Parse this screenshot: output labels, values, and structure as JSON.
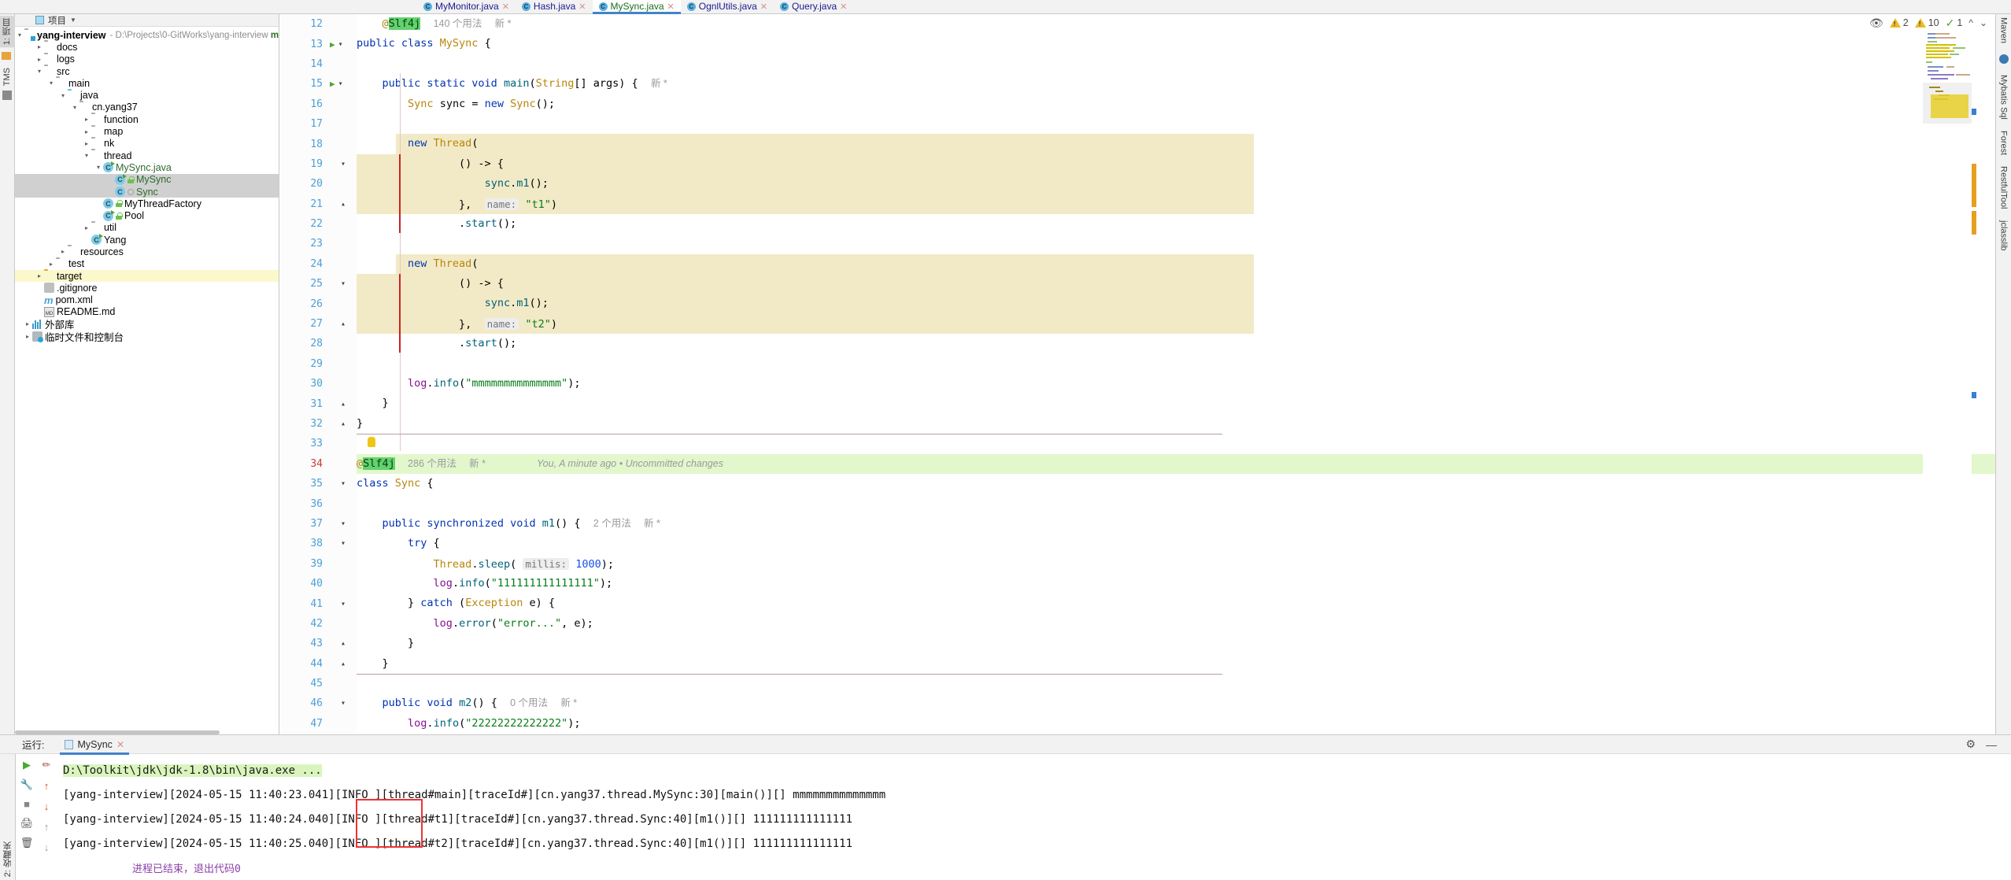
{
  "tabs": [
    {
      "label": "MyMonitor.java",
      "active": false
    },
    {
      "label": "Hash.java",
      "active": false
    },
    {
      "label": "MySync.java",
      "active": true
    },
    {
      "label": "OgnlUtils.java",
      "active": false
    },
    {
      "label": "Query.java",
      "active": false
    }
  ],
  "left_strip": {
    "project_label": "1: 项目",
    "tms_label": "TMS"
  },
  "right_strip": {
    "maven_label": "Maven",
    "mybatis_label": "Mybatis Sql",
    "forest_label": "Forest",
    "restful_label": "RestfulTool",
    "jclasslib_label": "jclasslib"
  },
  "project_panel": {
    "header_title": "项目",
    "root": "yang-interview",
    "root_path": "- D:\\Projects\\0-GitWorks\\yang-interview",
    "root_path_suffix": "ma",
    "items": [
      {
        "label": "docs",
        "depth": 1,
        "arrow": "right",
        "icon": "folder",
        "selected": false
      },
      {
        "label": "logs",
        "depth": 1,
        "arrow": "right",
        "icon": "folder",
        "selected": false
      },
      {
        "label": "src",
        "depth": 1,
        "arrow": "down",
        "icon": "folder",
        "selected": false
      },
      {
        "label": "main",
        "depth": 2,
        "arrow": "down",
        "icon": "folder",
        "selected": false
      },
      {
        "label": "java",
        "depth": 3,
        "arrow": "down",
        "icon": "folder-blue",
        "selected": false
      },
      {
        "label": "cn.yang37",
        "depth": 4,
        "arrow": "down",
        "icon": "package",
        "selected": false
      },
      {
        "label": "function",
        "depth": 5,
        "arrow": "right",
        "icon": "package",
        "selected": false
      },
      {
        "label": "map",
        "depth": 5,
        "arrow": "right",
        "icon": "package",
        "selected": false
      },
      {
        "label": "nk",
        "depth": 5,
        "arrow": "right",
        "icon": "package",
        "selected": false
      },
      {
        "label": "thread",
        "depth": 5,
        "arrow": "down",
        "icon": "package",
        "selected": false
      },
      {
        "label": "MySync.java",
        "depth": 6,
        "arrow": "down",
        "icon": "class-run",
        "selected": false,
        "green": true
      },
      {
        "label": "MySync",
        "depth": 7,
        "arrow": "none",
        "icon": "class-run",
        "modifier": "lock",
        "selected": true,
        "green": true
      },
      {
        "label": "Sync",
        "depth": 7,
        "arrow": "none",
        "icon": "class",
        "modifier": "circle",
        "selected": true,
        "green": true
      },
      {
        "label": "MyThreadFactory",
        "depth": 6,
        "arrow": "none",
        "icon": "class",
        "modifier": "lock",
        "selected": false,
        "green": false
      },
      {
        "label": "Pool",
        "depth": 6,
        "arrow": "none",
        "icon": "class-run",
        "modifier": "lock",
        "selected": false,
        "green": false
      },
      {
        "label": "util",
        "depth": 5,
        "arrow": "right",
        "icon": "package",
        "selected": false
      },
      {
        "label": "Yang",
        "depth": 5,
        "arrow": "none",
        "icon": "class-run",
        "selected": false
      },
      {
        "label": "resources",
        "depth": 3,
        "arrow": "right",
        "icon": "folder",
        "selected": false
      },
      {
        "label": "test",
        "depth": 2,
        "arrow": "right",
        "icon": "folder",
        "selected": false
      },
      {
        "label": "target",
        "depth": 1,
        "arrow": "right",
        "icon": "folder-orange",
        "selected": false,
        "highlight": true
      },
      {
        "label": ".gitignore",
        "depth": 1,
        "arrow": "none",
        "icon": "gitignore",
        "selected": false
      },
      {
        "label": "pom.xml",
        "depth": 1,
        "arrow": "none",
        "icon": "maven",
        "selected": false
      },
      {
        "label": "README.md",
        "depth": 1,
        "arrow": "none",
        "icon": "markdown",
        "selected": false
      },
      {
        "label": "外部库",
        "depth": 0,
        "arrow": "right",
        "icon": "library",
        "selected": false
      },
      {
        "label": "临时文件和控制台",
        "depth": 0,
        "arrow": "right",
        "icon": "scratch",
        "selected": false
      }
    ]
  },
  "editor": {
    "first_line": 12,
    "lines": [
      {
        "n": 12,
        "html": "    <span class=\"ann\">@</span><span class=\"slf4hl\">Slf4j</span>  <span class=\"usage\">140 个用法</span>  <span class=\"usage\">新 *</span>"
      },
      {
        "n": 13,
        "html": "<span class=\"kw\">public class </span><span class=\"typ\">MySync</span> {"
      },
      {
        "n": 14,
        "html": ""
      },
      {
        "n": 15,
        "html": "    <span class=\"kw\">public static void </span><span class=\"mth\">main</span>(<span class=\"typ\">String</span>[] args) {  <span class=\"usage\">新 *</span>"
      },
      {
        "n": 16,
        "html": "        <span class=\"typ\">Sync</span> <span class=\"plain\">sync</span> = <span class=\"kw\">new </span><span class=\"typ\">Sync</span>();"
      },
      {
        "n": 17,
        "html": ""
      },
      {
        "n": 18,
        "html": "        <span class=\"kw\">new </span><span class=\"typ\">Thread</span>("
      },
      {
        "n": 19,
        "html": "                () -&gt; {"
      },
      {
        "n": 20,
        "html": "                    <span class=\"mth\">sync</span>.<span class=\"mth\">m1</span>();"
      },
      {
        "n": 21,
        "html": "                },  <span class=\"hintp\">name:</span> <span class=\"str\">\"t1\"</span>)"
      },
      {
        "n": 22,
        "html": "                .<span class=\"mth\">start</span>();"
      },
      {
        "n": 23,
        "html": ""
      },
      {
        "n": 24,
        "html": "        <span class=\"kw\">new </span><span class=\"typ\">Thread</span>("
      },
      {
        "n": 25,
        "html": "                () -&gt; {"
      },
      {
        "n": 26,
        "html": "                    <span class=\"mth\">sync</span>.<span class=\"mth\">m1</span>();"
      },
      {
        "n": 27,
        "html": "                },  <span class=\"hintp\">name:</span> <span class=\"str\">\"t2\"</span>)"
      },
      {
        "n": 28,
        "html": "                .<span class=\"mth\">start</span>();"
      },
      {
        "n": 29,
        "html": ""
      },
      {
        "n": 30,
        "html": "        <span class=\"fld\">log</span>.<span class=\"mth\">info</span>(<span class=\"str\">\"mmmmmmmmmmmmmm\"</span>);"
      },
      {
        "n": 31,
        "html": "    }"
      },
      {
        "n": 32,
        "html": "}"
      },
      {
        "n": 33,
        "html": ""
      },
      {
        "n": 34,
        "html": "<span class=\"ann\">@</span><span class=\"slf4hl\">Slf4j</span>  <span class=\"usage\">286 个用法</span>  <span class=\"usage\">新 *</span>        <span class=\"blame\">You, A minute ago • Uncommitted changes</span>",
        "current": true
      },
      {
        "n": 35,
        "html": "<span class=\"kw\">class </span><span class=\"typ\">Sync</span> {"
      },
      {
        "n": 36,
        "html": ""
      },
      {
        "n": 37,
        "html": "    <span class=\"kw\">public synchronized void </span><span class=\"mth\">m1</span>() {  <span class=\"usage\">2 个用法</span>  <span class=\"usage\">新 *</span>"
      },
      {
        "n": 38,
        "html": "        <span class=\"kw\">try</span> {"
      },
      {
        "n": 39,
        "html": "            <span class=\"typ\">Thread</span>.<span class=\"mth\">sleep</span>( <span class=\"hintp\">millis:</span> <span class=\"num\">1000</span>);"
      },
      {
        "n": 40,
        "html": "            <span class=\"fld\">log</span>.<span class=\"mth\">info</span>(<span class=\"str\">\"111111111111111\"</span>);"
      },
      {
        "n": 41,
        "html": "        } <span class=\"kw\">catch</span> (<span class=\"typ\">Exception</span> e) {"
      },
      {
        "n": 42,
        "html": "            <span class=\"fld\">log</span>.<span class=\"mth\">error</span>(<span class=\"str\">\"error...\"</span>, e);"
      },
      {
        "n": 43,
        "html": "        }"
      },
      {
        "n": 44,
        "html": "    }"
      },
      {
        "n": 45,
        "html": ""
      },
      {
        "n": 46,
        "html": "    <span class=\"kw\">public void </span><span class=\"mth\">m2</span>() {  <span class=\"usage\">0 个用法</span>  <span class=\"usage\">新 *</span>"
      },
      {
        "n": 47,
        "html": "        <span class=\"fld\">log</span>.<span class=\"mth\">info</span>(<span class=\"str\">\"22222222222222\"</span>);"
      }
    ],
    "inspections": {
      "warn1_count": "2",
      "warn2_count": "10",
      "ok_count": "1"
    }
  },
  "run_panel": {
    "title": "运行:",
    "tab_label": "MySync",
    "command": "D:\\Toolkit\\jdk\\jdk-1.8\\bin\\java.exe ...",
    "lines": [
      "[yang-interview][2024-05-15 11:40:23.041][INFO ][thread#main][traceId#][cn.yang37.thread.MySync:30][main()][] mmmmmmmmmmmmmm",
      "[yang-interview][2024-05-15 11:40:24.040][INFO ][thread#t1][traceId#][cn.yang37.thread.Sync:40][m1()][] 111111111111111",
      "[yang-interview][2024-05-15 11:40:25.040][INFO ][thread#t2][traceId#][cn.yang37.thread.Sync:40][m1()][] 111111111111111"
    ],
    "footer_link": "进程已结束，退出代码0",
    "bottom_left_label": "2: 收藏夹"
  }
}
